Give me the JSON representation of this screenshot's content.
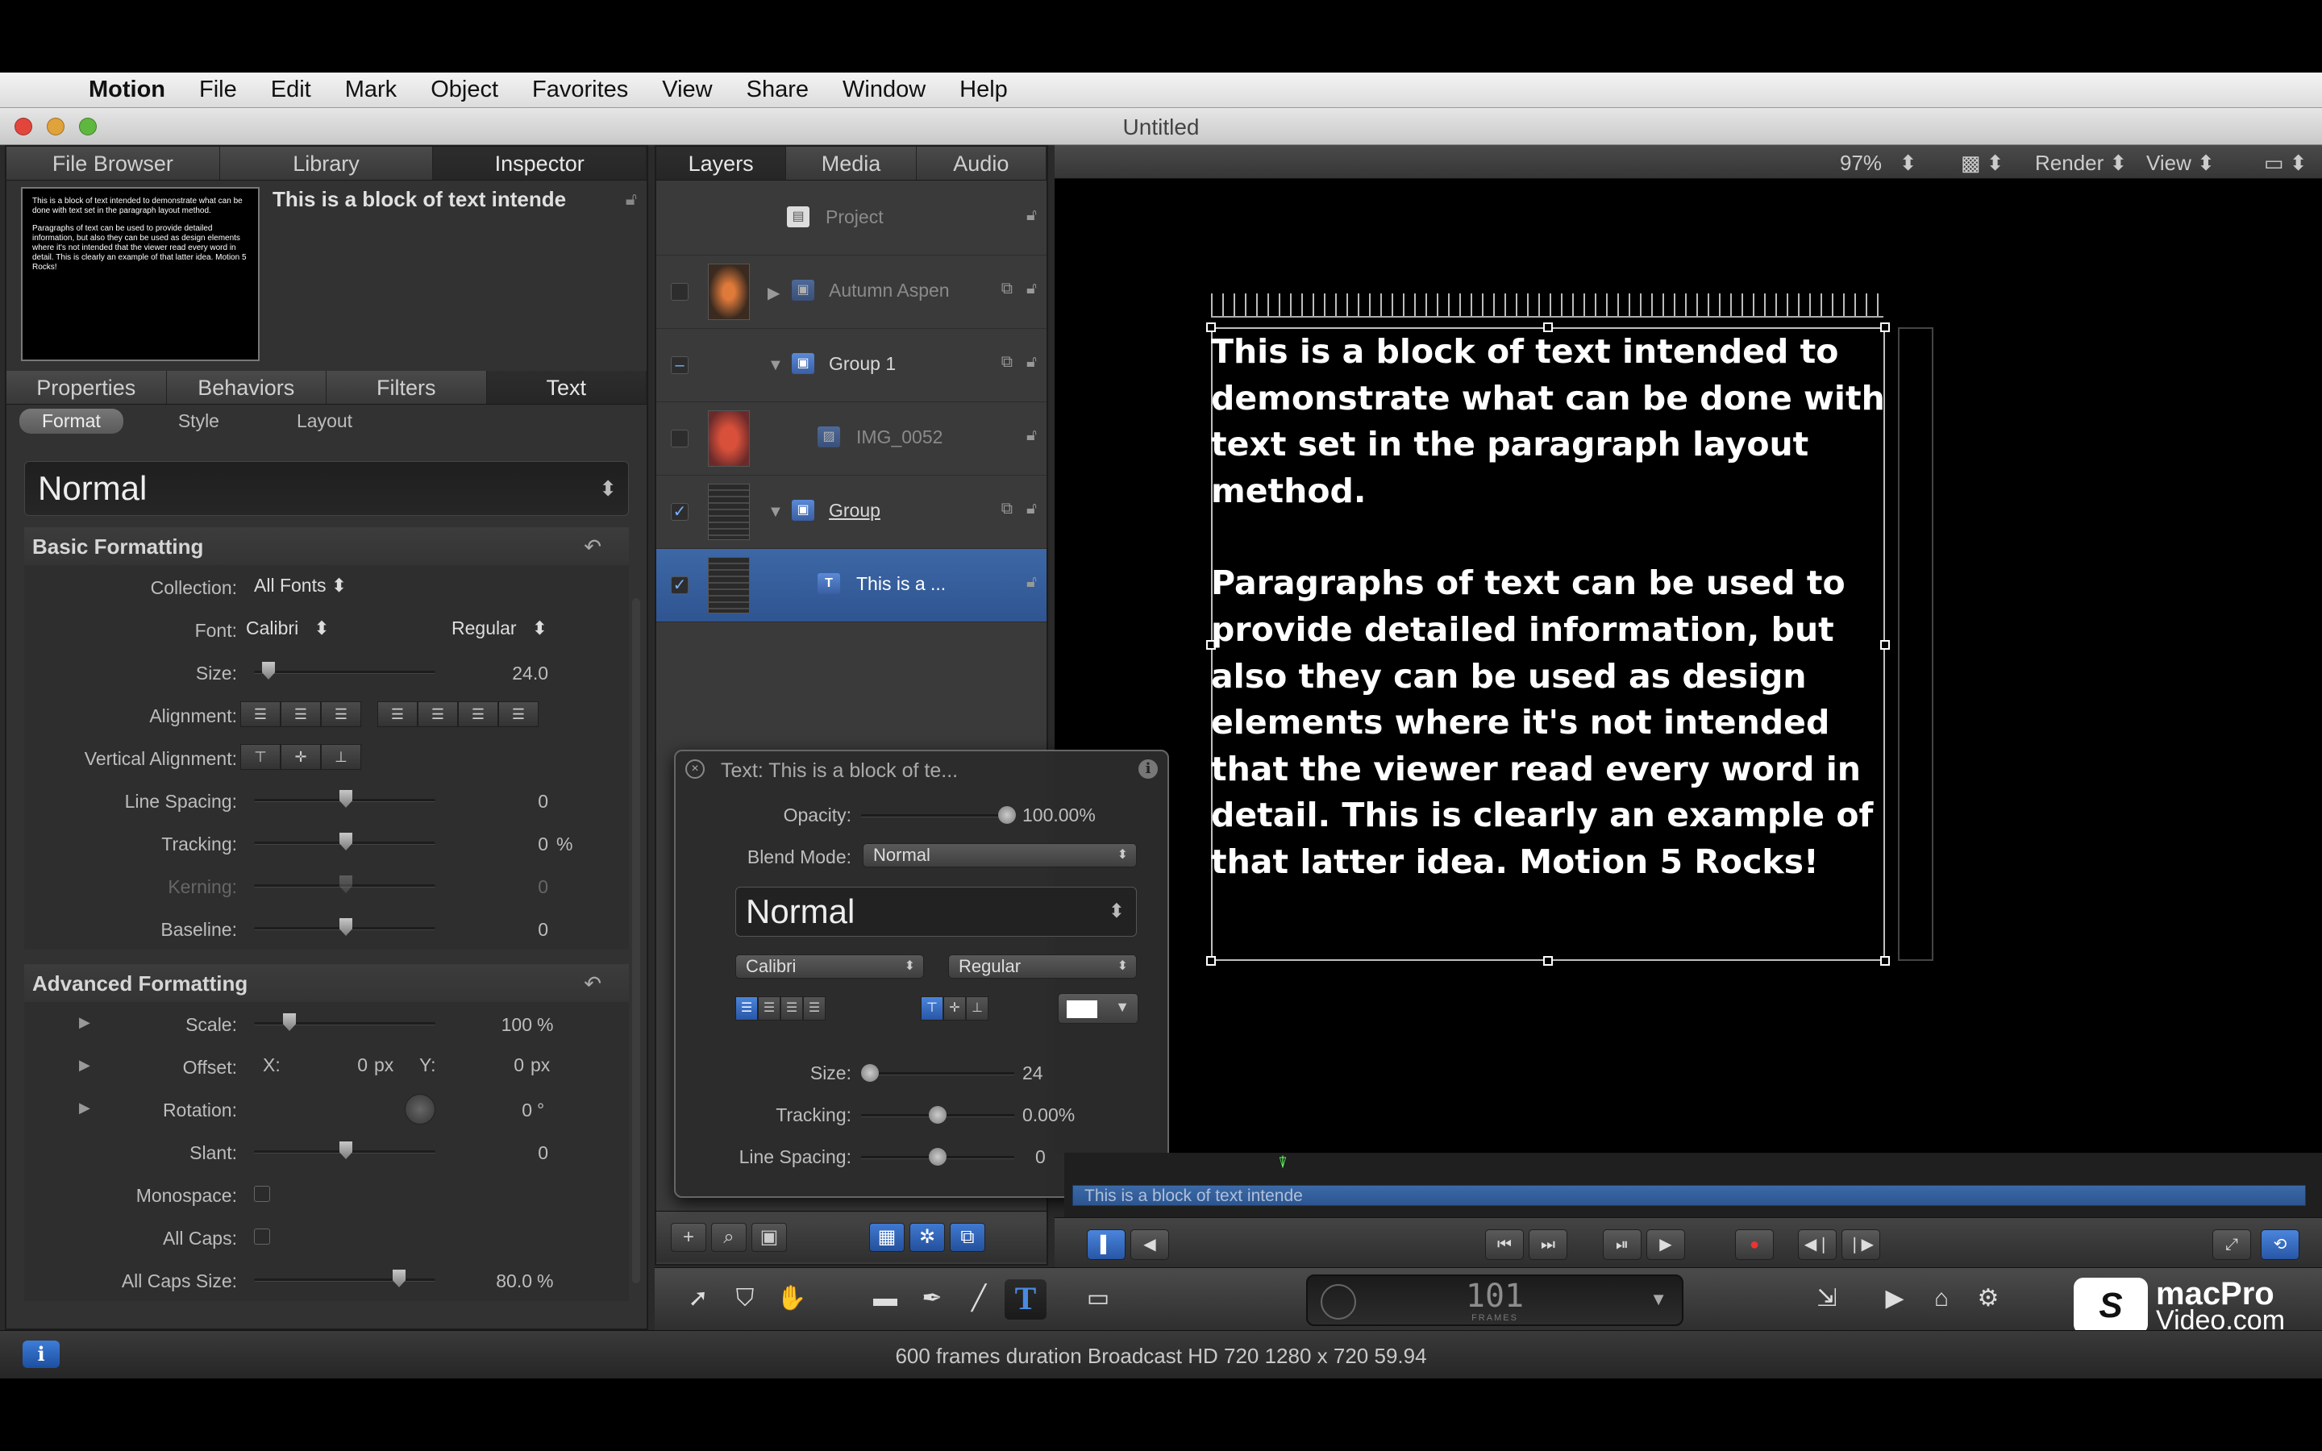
{
  "menubar": {
    "app": "Motion",
    "items": [
      "File",
      "Edit",
      "Mark",
      "Object",
      "Favorites",
      "View",
      "Share",
      "Window",
      "Help"
    ]
  },
  "window": {
    "title": "Untitled"
  },
  "left_panel": {
    "tabs": [
      "File Browser",
      "Library",
      "Inspector"
    ],
    "active_tab": "Inspector",
    "preview_title": "This is a block of text intende",
    "preview_text": [
      "This is a block of text intended to demonstrate what can be done with text set in the paragraph layout method.",
      "Paragraphs of text can be used  to provide detailed information, but also they can be used as design elements where it's not intended that the viewer read every word in detail. This is clearly an example of that latter idea. Motion 5 Rocks!"
    ],
    "sub_tabs": [
      "Properties",
      "Behaviors",
      "Filters",
      "Text"
    ],
    "active_sub_tab": "Text",
    "sub_sub_tabs": [
      "Format",
      "Style",
      "Layout"
    ],
    "active_sub_sub_tab": "Format",
    "preset": "Normal",
    "basic": {
      "title": "Basic Formatting",
      "collection_label": "Collection:",
      "collection_value": "All Fonts",
      "font_label": "Font:",
      "font_value": "Calibri",
      "font_style": "Regular",
      "size_label": "Size:",
      "size_value": "24.0",
      "alignment_label": "Alignment:",
      "valign_label": "Vertical Alignment:",
      "line_spacing_label": "Line Spacing:",
      "line_spacing_value": "0",
      "tracking_label": "Tracking:",
      "tracking_value": "0",
      "tracking_unit": "%",
      "kerning_label": "Kerning:",
      "kerning_value": "0",
      "baseline_label": "Baseline:",
      "baseline_value": "0"
    },
    "advanced": {
      "title": "Advanced Formatting",
      "scale_label": "Scale:",
      "scale_value": "100",
      "scale_unit": "%",
      "offset_label": "Offset:",
      "offset_x_label": "X:",
      "offset_x_value": "0",
      "offset_y_label": "Y:",
      "offset_y_value": "0",
      "px": "px",
      "rotation_label": "Rotation:",
      "rotation_value": "0",
      "rotation_unit": "°",
      "slant_label": "Slant:",
      "slant_value": "0",
      "monospace_label": "Monospace:",
      "allcaps_label": "All Caps:",
      "allcaps_size_label": "All Caps Size:",
      "allcaps_size_value": "80.0",
      "allcaps_size_unit": "%"
    }
  },
  "layers_panel": {
    "tabs": [
      "Layers",
      "Media",
      "Audio"
    ],
    "active_tab": "Layers",
    "rows": [
      {
        "name": "Project"
      },
      {
        "name": "Autumn Aspen"
      },
      {
        "name": "Group 1"
      },
      {
        "name": "IMG_0052"
      },
      {
        "name": "Group"
      },
      {
        "name": "This is a ..."
      }
    ]
  },
  "canvas_header": {
    "zoom": "97%",
    "render": "Render",
    "view": "View"
  },
  "canvas_text": [
    "This is a block of text intended to demonstrate what can be done with text set in the paragraph layout method.",
    "Paragraphs of text can be used  to provide detailed information, but also they can be used as design elements where it's not intended that the viewer read every word in detail. This is clearly an example of that latter idea. Motion 5 Rocks!"
  ],
  "hud": {
    "title": "Text: This is a block of te...",
    "opacity_label": "Opacity:",
    "opacity_value": "100.00%",
    "blend_label": "Blend Mode:",
    "blend_value": "Normal",
    "preset": "Normal",
    "font": "Calibri",
    "style": "Regular",
    "size_label": "Size:",
    "size_value": "24",
    "tracking_label": "Tracking:",
    "tracking_value": "0.00%",
    "line_spacing_label": "Line Spacing:",
    "line_spacing_value": "0"
  },
  "timeline": {
    "clip_label": "This is a block of text intende"
  },
  "timecode": {
    "value": "101",
    "label": "FRAMES"
  },
  "status": "600 frames duration Broadcast HD 720 1280 x 720 59.94",
  "logo": {
    "line1": "macPro",
    "line2": "Video.com"
  }
}
